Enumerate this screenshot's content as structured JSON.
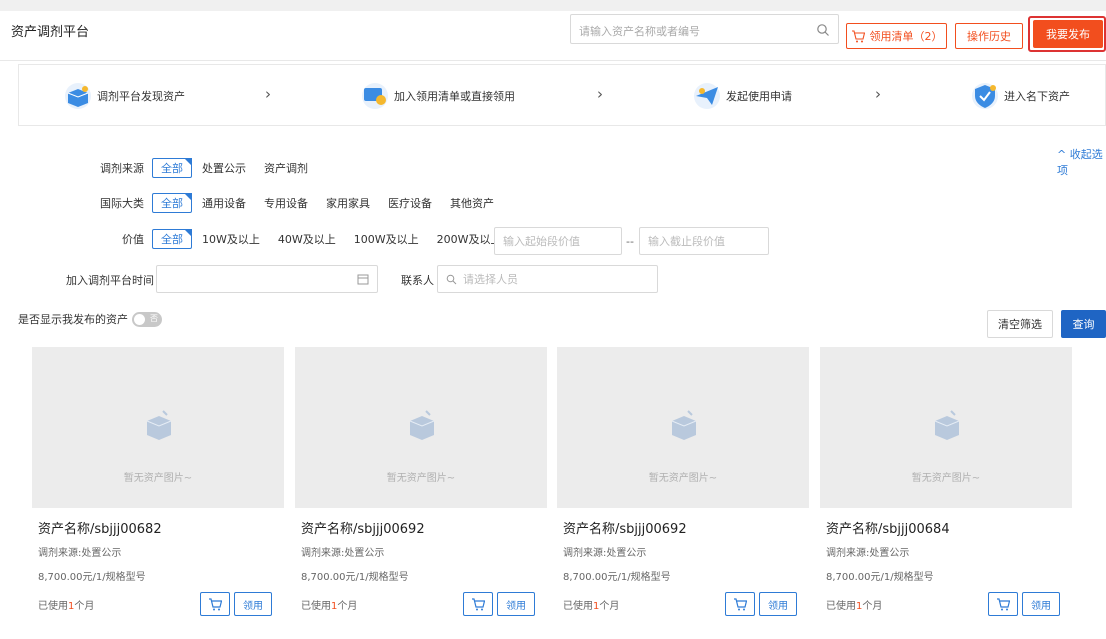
{
  "header": {
    "title": "资产调剂平台",
    "search_placeholder": "请输入资产名称或者编号",
    "cart_label": "领用清单（2）",
    "history_label": "操作历史",
    "publish_label": "我要发布"
  },
  "steps": [
    {
      "label": "调剂平台发现资产",
      "icon": "box-icon"
    },
    {
      "label": "加入领用清单或直接领用",
      "icon": "cart-screen-icon"
    },
    {
      "label": "发起使用申请",
      "icon": "paper-plane-icon"
    },
    {
      "label": "进入名下资产",
      "icon": "shield-check-icon"
    }
  ],
  "filters": {
    "collapse_label": "^ 收起选项",
    "source": {
      "label": "调剂来源",
      "options": [
        "全部",
        "处置公示",
        "资产调剂"
      ]
    },
    "category": {
      "label": "国际大类",
      "options": [
        "全部",
        "通用设备",
        "专用设备",
        "家用家具",
        "医疗设备",
        "其他资产"
      ]
    },
    "value": {
      "label": "价值",
      "options": [
        "全部",
        "10W及以上",
        "40W及以上",
        "100W及以上",
        "200W及以上"
      ],
      "start_placeholder": "输入起始段价值",
      "sep": "--",
      "end_placeholder": "输入截止段价值"
    },
    "join_time": {
      "label": "加入调剂平台时间"
    },
    "contact": {
      "label": "联系人",
      "placeholder": "请选择人员"
    },
    "show_mine": {
      "label": "是否显示我发布的资产",
      "state": "否"
    },
    "clear_label": "清空筛选",
    "query_label": "查询"
  },
  "cards": [
    {
      "no_image": "暂无资产图片~",
      "name": "资产名称/sbjjj00682",
      "source": "调剂来源:处置公示",
      "price": "8,700.00元/1/规格型号",
      "used_prefix": "已使用",
      "used_num": "1",
      "used_suffix": "个月",
      "get_label": "领用"
    },
    {
      "no_image": "暂无资产图片~",
      "name": "资产名称/sbjjj00692",
      "source": "调剂来源:处置公示",
      "price": "8,700.00元/1/规格型号",
      "used_prefix": "已使用",
      "used_num": "1",
      "used_suffix": "个月",
      "get_label": "领用"
    },
    {
      "no_image": "暂无资产图片~",
      "name": "资产名称/sbjjj00692",
      "source": "调剂来源:处置公示",
      "price": "8,700.00元/1/规格型号",
      "used_prefix": "已使用",
      "used_num": "1",
      "used_suffix": "个月",
      "get_label": "领用"
    },
    {
      "no_image": "暂无资产图片~",
      "name": "资产名称/sbjjj00684",
      "source": "调剂来源:处置公示",
      "price": "8,700.00元/1/规格型号",
      "used_prefix": "已使用",
      "used_num": "1",
      "used_suffix": "个月",
      "get_label": "领用"
    }
  ],
  "colors": {
    "accent": "#f24e1e",
    "primary": "#1f65c4",
    "link": "#2e7bd6"
  }
}
